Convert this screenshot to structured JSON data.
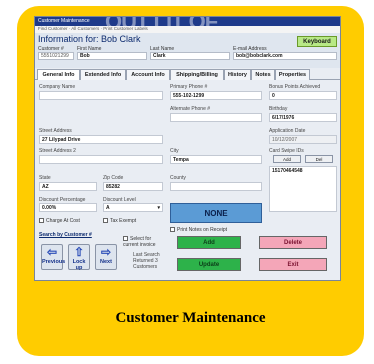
{
  "caption": "Customer Maintenance",
  "window": {
    "title": "Customer Maintenance",
    "ghost_text": "OUT LIT OF",
    "breadcrumbs": "Find Customer · All Customers · Print Customer Labels",
    "info_title": "Information for: Bob Clark",
    "keyboard_label": "Keyboard"
  },
  "header_fields": {
    "customer_label": "Customer #",
    "customer_value": "5551021299",
    "first_label": "First Name",
    "first_value": "Bob",
    "last_label": "Last Name",
    "last_value": "Clark",
    "email_label": "E-mail Address",
    "email_value": "bob@bobclark.com"
  },
  "tabs": [
    "General Info",
    "Extended Info",
    "Account Info",
    "Shipping/Billing",
    "History",
    "Notes",
    "Properties"
  ],
  "form": {
    "company_label": "Company Name",
    "company_value": "",
    "primary_phone_label": "Primary Phone #",
    "primary_phone_value": "555-102-1299",
    "bonus_label": "Bonus Points Achieved",
    "bonus_value": "0",
    "alt_phone_label": "Alternate Phone #",
    "alt_phone_value": "",
    "birthday_label": "Birthday",
    "birthday_value": "6/17/1976",
    "street_label": "Street Address",
    "street_value": "27 Lilypad Drive",
    "street2_label": "Street Address 2",
    "street2_value": "",
    "city_label": "City",
    "city_value": "Tempa",
    "app_date_label": "Application Date",
    "app_date_value": "10/12/2007",
    "state_label": "State",
    "state_value": "AZ",
    "zip_label": "Zip Code",
    "zip_value": "85282",
    "county_label": "County",
    "county_value": "",
    "card_label": "Card Swipe IDs",
    "card_add": "Add",
    "card_del": "Del",
    "card_value": "15170464548",
    "discount_pct_label": "Discount Percentage",
    "discount_pct_value": "0.00%",
    "discount_level_label": "Discount Level",
    "discount_level_value": "A",
    "none_label": "NONE",
    "charge_label": "Charge At Cost",
    "tax_label": "Tax Exempt",
    "print_notes_label": "Print Notes on Receipt"
  },
  "bottom": {
    "search_by": "Search by Customer #",
    "prev_label": "Previous",
    "lock_label": "Lock up",
    "next_label": "Next",
    "select_label": "Select for current invoice",
    "last_search_label": "Last Search Returned 3 Customers",
    "add_label": "Add",
    "delete_label": "Delete",
    "update_label": "Update",
    "exit_label": "Exit"
  },
  "colors": {
    "card": "#FFCC00",
    "add": "#2db24a",
    "delete": "#f4a6b8",
    "none_box": "#5b9bd5"
  }
}
